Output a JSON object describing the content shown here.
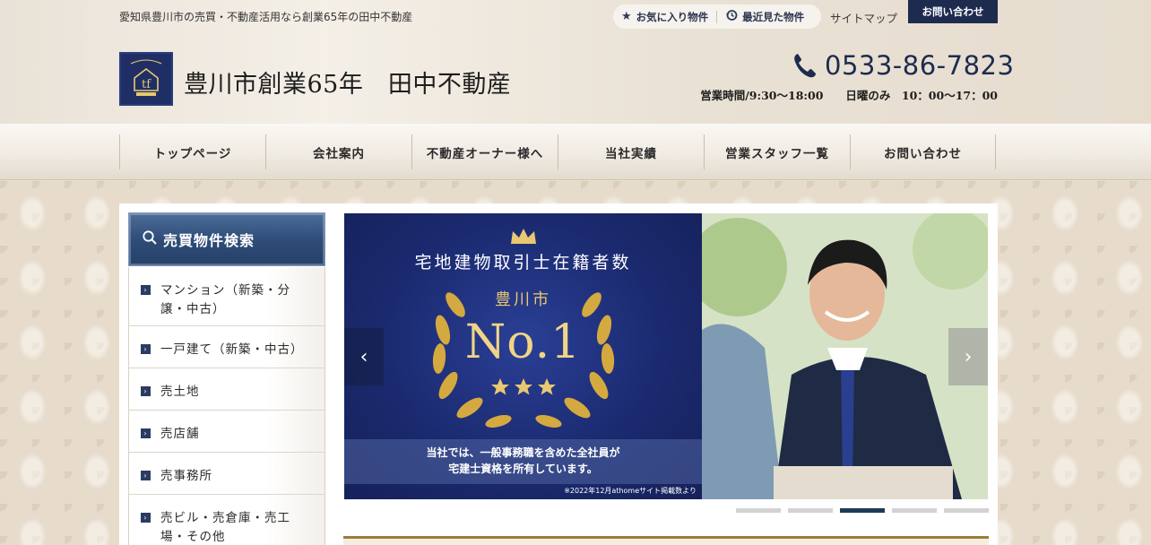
{
  "header": {
    "tagline": "愛知県豊川市の売買・不動産活用なら創業65年の田中不動産",
    "favorites_label": "お気に入り物件",
    "recent_label": "最近見た物件",
    "sitemap_label": "サイトマップ",
    "contact_label": "お問い合わせ",
    "site_title": "豊川市創業65年　田中不動産",
    "logo_mark": "tf",
    "phone": "0533-86-7823",
    "hours": "営業時間/9:30～18:00　　日曜のみ　10：00～17：00",
    "brand_color": "#1d2b4f"
  },
  "nav": {
    "items": [
      {
        "label": "トップページ"
      },
      {
        "label": "会社案内"
      },
      {
        "label": "不動産オーナー様へ"
      },
      {
        "label": "当社実績"
      },
      {
        "label": "営業スタッフ一覧"
      },
      {
        "label": "お問い合わせ"
      }
    ]
  },
  "sidebar": {
    "title": "売買物件検索",
    "items": [
      {
        "label": "マンション（新築・分譲・中古）"
      },
      {
        "label": "一戸建て（新築・中古）"
      },
      {
        "label": "売土地"
      },
      {
        "label": "売店舗"
      },
      {
        "label": "売事務所"
      },
      {
        "label": "売ビル・売倉庫・売工場・その他"
      }
    ]
  },
  "slider": {
    "heading": "宅地建物取引士在籍者数",
    "city": "豊川市",
    "rank": "No.1",
    "caption_line1": "当社では、一般事務職を含めた全社員が",
    "caption_line2": "宅建士資格を所有しています。",
    "note": "※2022年12月athomeサイト掲載数より",
    "prev_icon": "chevron-left-icon",
    "next_icon": "chevron-right-icon",
    "dot_count": 5,
    "active_dot": 3
  }
}
